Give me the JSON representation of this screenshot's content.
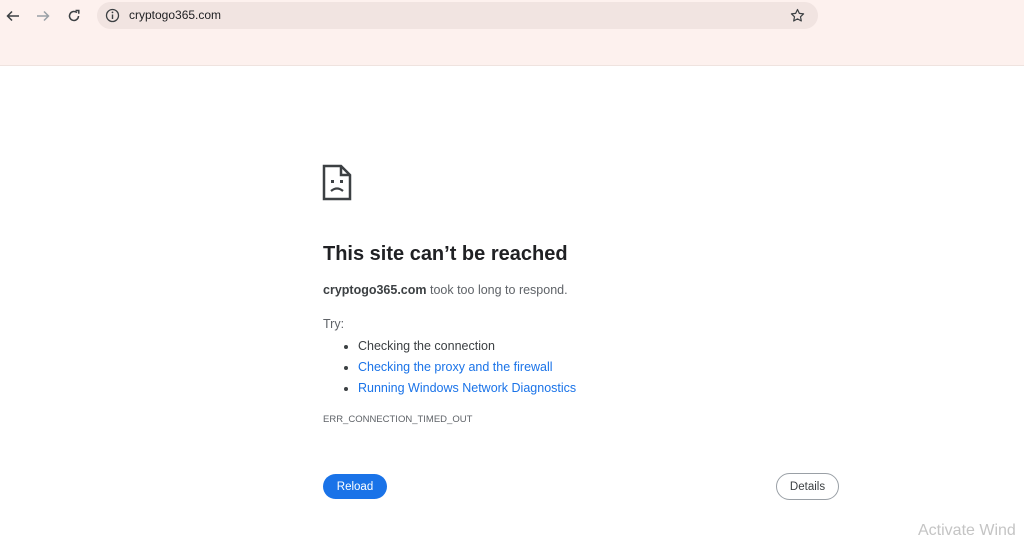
{
  "toolbar": {
    "back_icon": "arrow-left-icon",
    "forward_icon": "arrow-right-icon",
    "reload_icon": "reload-icon",
    "site_info_icon": "info-icon",
    "bookmark_icon": "star-icon",
    "url": "cryptogo365.com"
  },
  "error": {
    "icon": "sad-page-icon",
    "title": "This site can’t be reached",
    "host": "cryptogo365.com",
    "message_suffix": " took too long to respond.",
    "try_label": "Try:",
    "suggestions": [
      "Checking the connection",
      "Checking the proxy and the firewall",
      "Running Windows Network Diagnostics"
    ],
    "error_code": "ERR_CONNECTION_TIMED_OUT",
    "reload_label": "Reload",
    "details_label": "Details"
  },
  "watermark": "Activate Wind",
  "colors": {
    "accent": "#1a73e8",
    "chrome_bg": "#fdf1ee",
    "omnibox_bg": "#f1e4e1",
    "title_text": "#202124"
  }
}
